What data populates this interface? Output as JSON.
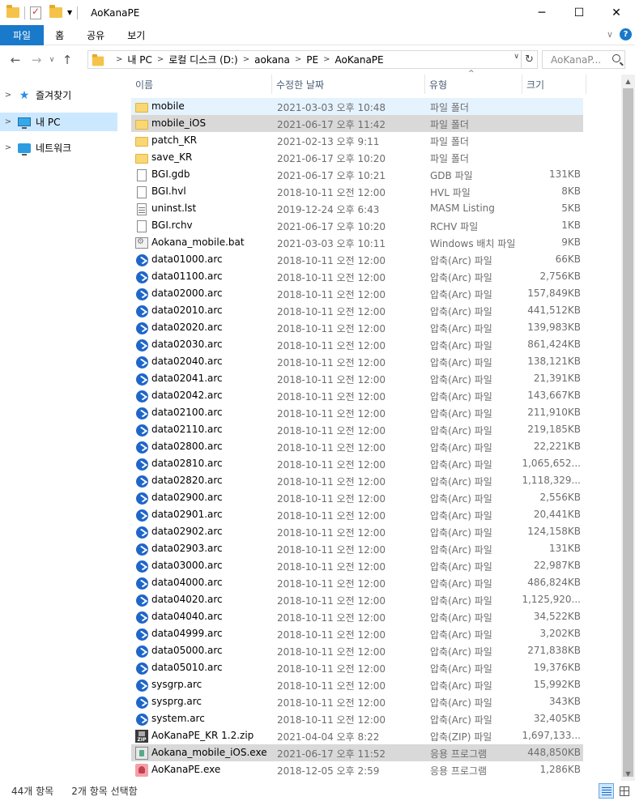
{
  "window": {
    "title": "AoKanaPE",
    "minimize": "─",
    "maximize": "☐",
    "close": "✕"
  },
  "ribbon": {
    "tabs": [
      "파일",
      "홈",
      "공유",
      "보기"
    ],
    "expand_glyph": "∨",
    "help_glyph": "?"
  },
  "address": {
    "breadcrumbs": [
      "내 PC",
      "로컬 디스크 (D:)",
      "aokana",
      "PE",
      "AoKanaPE"
    ],
    "search_placeholder": "AoKanaP..."
  },
  "navpane": {
    "items": [
      {
        "label": "즐겨찾기",
        "icon": "star-icon",
        "selected": false
      },
      {
        "label": "내 PC",
        "icon": "pc-icon",
        "selected": true
      },
      {
        "label": "네트워크",
        "icon": "network-icon",
        "selected": false
      }
    ]
  },
  "columns": {
    "name": "이름",
    "date": "수정한 날짜",
    "type": "유형",
    "size": "크기"
  },
  "files": [
    {
      "name": "mobile",
      "date": "2021-03-03 오후 10:48",
      "type": "파일 폴더",
      "size": "",
      "icon": "folder",
      "state": "hover"
    },
    {
      "name": "mobile_iOS",
      "date": "2021-06-17 오후 11:42",
      "type": "파일 폴더",
      "size": "",
      "icon": "folder",
      "state": "selected"
    },
    {
      "name": "patch_KR",
      "date": "2021-02-13 오후 9:11",
      "type": "파일 폴더",
      "size": "",
      "icon": "folder",
      "state": ""
    },
    {
      "name": "save_KR",
      "date": "2021-06-17 오후 10:20",
      "type": "파일 폴더",
      "size": "",
      "icon": "folder",
      "state": ""
    },
    {
      "name": "BGI.gdb",
      "date": "2021-06-17 오후 10:21",
      "type": "GDB 파일",
      "size": "131KB",
      "icon": "doc",
      "state": ""
    },
    {
      "name": "BGI.hvl",
      "date": "2018-10-11 오전 12:00",
      "type": "HVL 파일",
      "size": "8KB",
      "icon": "doc",
      "state": ""
    },
    {
      "name": "uninst.lst",
      "date": "2019-12-24 오후 6:43",
      "type": "MASM Listing",
      "size": "5KB",
      "icon": "txt",
      "state": ""
    },
    {
      "name": "BGI.rchv",
      "date": "2021-06-17 오후 10:20",
      "type": "RCHV 파일",
      "size": "1KB",
      "icon": "doc",
      "state": ""
    },
    {
      "name": "Aokana_mobile.bat",
      "date": "2021-03-03 오후 10:11",
      "type": "Windows 배치 파일",
      "size": "9KB",
      "icon": "bat",
      "state": ""
    },
    {
      "name": "data01000.arc",
      "date": "2018-10-11 오전 12:00",
      "type": "압축(Arc) 파일",
      "size": "66KB",
      "icon": "arc",
      "state": ""
    },
    {
      "name": "data01100.arc",
      "date": "2018-10-11 오전 12:00",
      "type": "압축(Arc) 파일",
      "size": "2,756KB",
      "icon": "arc",
      "state": ""
    },
    {
      "name": "data02000.arc",
      "date": "2018-10-11 오전 12:00",
      "type": "압축(Arc) 파일",
      "size": "157,849KB",
      "icon": "arc",
      "state": ""
    },
    {
      "name": "data02010.arc",
      "date": "2018-10-11 오전 12:00",
      "type": "압축(Arc) 파일",
      "size": "441,512KB",
      "icon": "arc",
      "state": ""
    },
    {
      "name": "data02020.arc",
      "date": "2018-10-11 오전 12:00",
      "type": "압축(Arc) 파일",
      "size": "139,983KB",
      "icon": "arc",
      "state": ""
    },
    {
      "name": "data02030.arc",
      "date": "2018-10-11 오전 12:00",
      "type": "압축(Arc) 파일",
      "size": "861,424KB",
      "icon": "arc",
      "state": ""
    },
    {
      "name": "data02040.arc",
      "date": "2018-10-11 오전 12:00",
      "type": "압축(Arc) 파일",
      "size": "138,121KB",
      "icon": "arc",
      "state": ""
    },
    {
      "name": "data02041.arc",
      "date": "2018-10-11 오전 12:00",
      "type": "압축(Arc) 파일",
      "size": "21,391KB",
      "icon": "arc",
      "state": ""
    },
    {
      "name": "data02042.arc",
      "date": "2018-10-11 오전 12:00",
      "type": "압축(Arc) 파일",
      "size": "143,667KB",
      "icon": "arc",
      "state": ""
    },
    {
      "name": "data02100.arc",
      "date": "2018-10-11 오전 12:00",
      "type": "압축(Arc) 파일",
      "size": "211,910KB",
      "icon": "arc",
      "state": ""
    },
    {
      "name": "data02110.arc",
      "date": "2018-10-11 오전 12:00",
      "type": "압축(Arc) 파일",
      "size": "219,185KB",
      "icon": "arc",
      "state": ""
    },
    {
      "name": "data02800.arc",
      "date": "2018-10-11 오전 12:00",
      "type": "압축(Arc) 파일",
      "size": "22,221KB",
      "icon": "arc",
      "state": ""
    },
    {
      "name": "data02810.arc",
      "date": "2018-10-11 오전 12:00",
      "type": "압축(Arc) 파일",
      "size": "1,065,652...",
      "icon": "arc",
      "state": ""
    },
    {
      "name": "data02820.arc",
      "date": "2018-10-11 오전 12:00",
      "type": "압축(Arc) 파일",
      "size": "1,118,329...",
      "icon": "arc",
      "state": ""
    },
    {
      "name": "data02900.arc",
      "date": "2018-10-11 오전 12:00",
      "type": "압축(Arc) 파일",
      "size": "2,556KB",
      "icon": "arc",
      "state": ""
    },
    {
      "name": "data02901.arc",
      "date": "2018-10-11 오전 12:00",
      "type": "압축(Arc) 파일",
      "size": "20,441KB",
      "icon": "arc",
      "state": ""
    },
    {
      "name": "data02902.arc",
      "date": "2018-10-11 오전 12:00",
      "type": "압축(Arc) 파일",
      "size": "124,158KB",
      "icon": "arc",
      "state": ""
    },
    {
      "name": "data02903.arc",
      "date": "2018-10-11 오전 12:00",
      "type": "압축(Arc) 파일",
      "size": "131KB",
      "icon": "arc",
      "state": ""
    },
    {
      "name": "data03000.arc",
      "date": "2018-10-11 오전 12:00",
      "type": "압축(Arc) 파일",
      "size": "22,987KB",
      "icon": "arc",
      "state": ""
    },
    {
      "name": "data04000.arc",
      "date": "2018-10-11 오전 12:00",
      "type": "압축(Arc) 파일",
      "size": "486,824KB",
      "icon": "arc",
      "state": ""
    },
    {
      "name": "data04020.arc",
      "date": "2018-10-11 오전 12:00",
      "type": "압축(Arc) 파일",
      "size": "1,125,920...",
      "icon": "arc",
      "state": ""
    },
    {
      "name": "data04040.arc",
      "date": "2018-10-11 오전 12:00",
      "type": "압축(Arc) 파일",
      "size": "34,522KB",
      "icon": "arc",
      "state": ""
    },
    {
      "name": "data04999.arc",
      "date": "2018-10-11 오전 12:00",
      "type": "압축(Arc) 파일",
      "size": "3,202KB",
      "icon": "arc",
      "state": ""
    },
    {
      "name": "data05000.arc",
      "date": "2018-10-11 오전 12:00",
      "type": "압축(Arc) 파일",
      "size": "271,838KB",
      "icon": "arc",
      "state": ""
    },
    {
      "name": "data05010.arc",
      "date": "2018-10-11 오전 12:00",
      "type": "압축(Arc) 파일",
      "size": "19,376KB",
      "icon": "arc",
      "state": ""
    },
    {
      "name": "sysgrp.arc",
      "date": "2018-10-11 오전 12:00",
      "type": "압축(Arc) 파일",
      "size": "15,992KB",
      "icon": "arc",
      "state": ""
    },
    {
      "name": "sysprg.arc",
      "date": "2018-10-11 오전 12:00",
      "type": "압축(Arc) 파일",
      "size": "343KB",
      "icon": "arc",
      "state": ""
    },
    {
      "name": "system.arc",
      "date": "2018-10-11 오전 12:00",
      "type": "압축(Arc) 파일",
      "size": "32,405KB",
      "icon": "arc",
      "state": ""
    },
    {
      "name": "AoKanaPE_KR 1.2.zip",
      "date": "2021-04-04 오후 8:22",
      "type": "압축(ZIP) 파일",
      "size": "1,697,133...",
      "icon": "zip",
      "state": ""
    },
    {
      "name": "Aokana_mobile_iOS.exe",
      "date": "2021-06-17 오후 11:52",
      "type": "응용 프로그램",
      "size": "448,850KB",
      "icon": "exe1",
      "state": "selected"
    },
    {
      "name": "AoKanaPE.exe",
      "date": "2018-12-05 오후 2:59",
      "type": "응용 프로그램",
      "size": "1,286KB",
      "icon": "exe2",
      "state": ""
    }
  ],
  "statusbar": {
    "item_count": "44개 항목",
    "selected_count": "2개 항목 선택함"
  },
  "colors": {
    "accent": "#1979ca",
    "hover_row": "#e5f3ff",
    "selected_row": "#d9d9d9",
    "nav_selected": "#cce8ff"
  }
}
